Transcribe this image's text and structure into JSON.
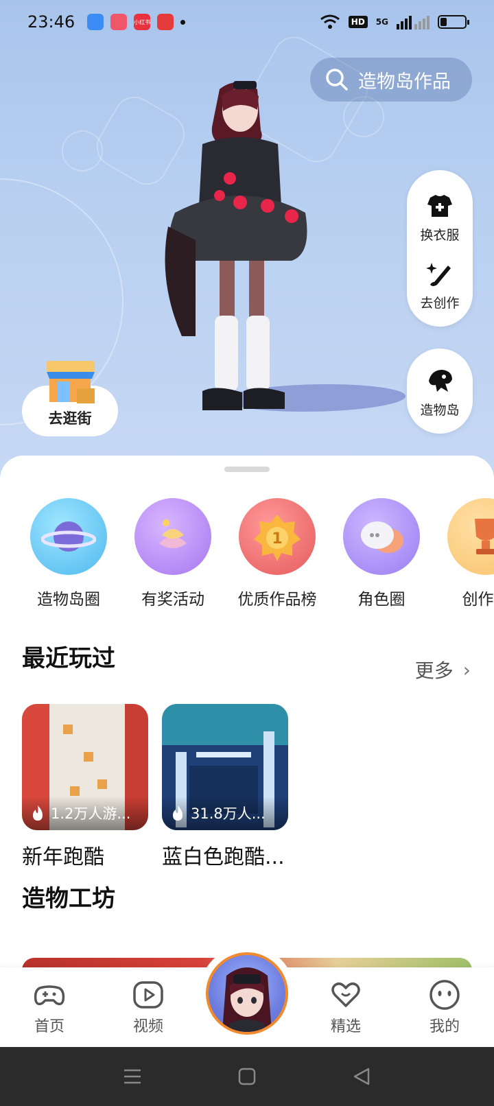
{
  "status_bar": {
    "time": "23:46",
    "notification_icons": [
      {
        "name": "app-icon-blue",
        "color": "#3c8cf5"
      },
      {
        "name": "app-icon-pink",
        "color": "#f0566a"
      },
      {
        "name": "xiaohongshu-icon",
        "color": "#e8323f",
        "text": "小红书"
      },
      {
        "name": "app-icon-red",
        "color": "#e63b3b"
      }
    ],
    "network_badge": "HD",
    "signal_type": "5G",
    "battery_percent": 25
  },
  "hero": {
    "search_label": "造物岛作品",
    "side_buttons": [
      {
        "label": "换衣服",
        "icon": "tshirt-plus-icon"
      },
      {
        "label": "去创作",
        "icon": "magic-wand-icon"
      }
    ],
    "island_button": {
      "label": "造物岛",
      "icon": "island-icon"
    },
    "street_button": {
      "label": "去逛街",
      "icon": "shop-icon"
    }
  },
  "categories": [
    {
      "label": "造物岛圈",
      "icon": "planet-icon",
      "color": "#5ec8f0"
    },
    {
      "label": "有奖活动",
      "icon": "gift-spiral-icon",
      "color": "#b58cf5"
    },
    {
      "label": "优质作品榜",
      "icon": "medal-icon",
      "color": "#f06a6a"
    },
    {
      "label": "角色圈",
      "icon": "chat-bubble-icon",
      "color": "#a88af5"
    },
    {
      "label": "创作大",
      "icon": "trophy-icon",
      "color": "#fbbf68"
    }
  ],
  "recent": {
    "title": "最近玩过",
    "more_label": "更多",
    "items": [
      {
        "title": "新年跑酷",
        "players": "1.2万人游..."
      },
      {
        "title": "蓝白色跑酷...",
        "players": "31.8万人..."
      }
    ]
  },
  "workshop": {
    "title": "造物工坊"
  },
  "tabbar": {
    "tabs": [
      {
        "label": "首页",
        "icon": "gamepad-icon"
      },
      {
        "label": "视频",
        "icon": "video-play-icon"
      },
      {
        "label": "精选",
        "icon": "heart-icon"
      },
      {
        "label": "我的",
        "icon": "smiley-face-icon"
      }
    ]
  },
  "colors": {
    "accent_orange": "#f08a2c",
    "hero_bg": "#b9d0f1"
  }
}
